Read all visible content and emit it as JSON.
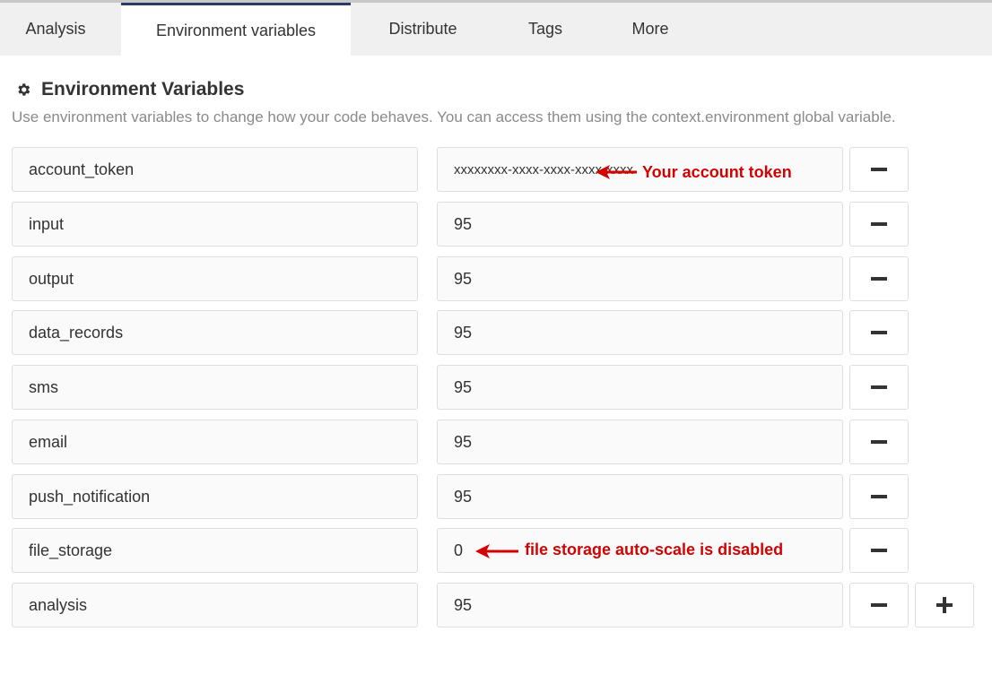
{
  "tabs": [
    {
      "label": "Analysis",
      "active": false
    },
    {
      "label": "Environment variables",
      "active": true
    },
    {
      "label": "Distribute",
      "active": false
    },
    {
      "label": "Tags",
      "active": false
    },
    {
      "label": "More",
      "active": false
    }
  ],
  "section": {
    "icon": "gear-icon",
    "title": "Environment Variables",
    "description": "Use environment variables to change how your code behaves. You can access them using the context.environment global variable."
  },
  "variables": [
    {
      "key": "account_token",
      "value": "xxxxxxxx-xxxx-xxxx-xxxx-xxxx"
    },
    {
      "key": "input",
      "value": "95"
    },
    {
      "key": "output",
      "value": "95"
    },
    {
      "key": "data_records",
      "value": "95"
    },
    {
      "key": "sms",
      "value": "95"
    },
    {
      "key": "email",
      "value": "95"
    },
    {
      "key": "push_notification",
      "value": "95"
    },
    {
      "key": "file_storage",
      "value": "0"
    },
    {
      "key": "analysis",
      "value": "95"
    }
  ],
  "annotations": {
    "account_token_note": "Your account token",
    "file_storage_note": "file storage auto-scale is disabled",
    "color": "#d50000"
  },
  "colors": {
    "tab_active_border": "#2b3a66",
    "tab_bar_bg": "#f0f0f0"
  }
}
